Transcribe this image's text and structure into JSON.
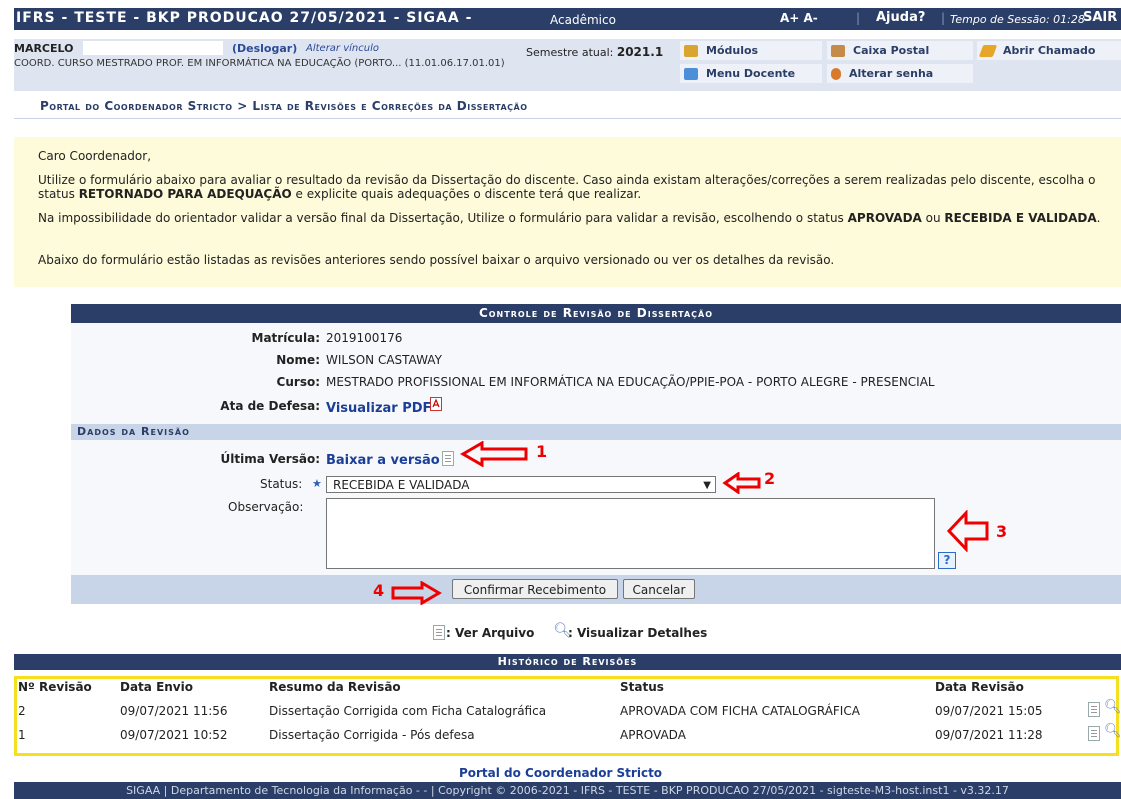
{
  "topbar": {
    "title": "IFRS - TESTE - BKP PRODUCAO 27/05/2021 - SIGAA -",
    "subtitle": "Acadêmico",
    "font_controls": "A+ A-",
    "help": "Ajuda?",
    "session": "Tempo de Sessão: 01:28",
    "logout": "SAIR"
  },
  "info": {
    "user": "MARCELO",
    "deslogar": "(Deslogar)",
    "alterar_vinculo": "Alterar vínculo",
    "coord": "COORD. CURSO MESTRADO PROF. EM INFORMÁTICA NA EDUCAÇÃO (PORTO... (11.01.06.17.01.01)",
    "semestre_label": "Semestre atual:",
    "semestre_value": "2021.1"
  },
  "menu": {
    "modulos": "Módulos",
    "caixa_postal": "Caixa Postal",
    "abrir_chamado": "Abrir Chamado",
    "menu_docente": "Menu Docente",
    "alterar_senha": "Alterar senha"
  },
  "breadcrumb": "Portal do Coordenador Stricto > Lista de Revisões e Correções da Dissertação",
  "notice": {
    "greeting": "Caro Coordenador,",
    "p1_a": "Utilize o formulário abaixo para avaliar o resultado da revisão da Dissertação do discente. Caso ainda existam alterações/correções a serem realizadas pelo discente, escolha o status ",
    "p1_b": "RETORNADO PARA ADEQUAÇÃO",
    "p1_c": " e explicite quais adequações o discente terá que realizar.",
    "p2_a": "Na impossibilidade do orientador validar a versão final da Dissertação, Utilize o formulário para validar a revisão, escolhendo o status ",
    "p2_b": "APROVADA",
    "p2_c": " ou ",
    "p2_d": "RECEBIDA E VALIDADA",
    "p2_e": ".",
    "p3": "Abaixo do formulário estão listadas as revisões anteriores sendo possível baixar o arquivo versionado ou ver os detalhes da revisão."
  },
  "form": {
    "header": "Controle de Revisão de Dissertação",
    "matricula_label": "Matrícula:",
    "matricula": "2019100176",
    "nome_label": "Nome:",
    "nome": "WILSON CASTAWAY",
    "curso_label": "Curso:",
    "curso": "MESTRADO PROFISSIONAL EM INFORMÁTICA NA EDUCAÇÃO/PPIE-POA - PORTO ALEGRE - PRESENCIAL",
    "ata_label": "Ata de Defesa:",
    "ata_link": "Visualizar PDF",
    "dados_header": "Dados da Revisão",
    "ultima_label": "Última Versão:",
    "ultima_link": "Baixar a versão",
    "status_label": "Status:",
    "status_value": "RECEBIDA E VALIDADA",
    "obs_label": "Observação:",
    "help": "?",
    "confirm": "Confirmar Recebimento",
    "cancel": "Cancelar"
  },
  "annotations": {
    "a1": "1",
    "a2": "2",
    "a3": "3",
    "a4": "4",
    "color": "#e00000"
  },
  "legend": {
    "ver_arquivo": ": Ver Arquivo",
    "visualizar": ": Visualizar Detalhes"
  },
  "history": {
    "header": "Histórico de Revisões",
    "columns": [
      "Nº Revisão",
      "Data Envio",
      "Resumo da Revisão",
      "Status",
      "Data Revisão"
    ],
    "rows": [
      [
        "2",
        "09/07/2021 11:56",
        "Dissertação Corrigida com Ficha Catalográfica",
        "APROVADA COM FICHA CATALOGRÁFICA",
        "09/07/2021 15:05"
      ],
      [
        "1",
        "09/07/2021 10:52",
        "Dissertação Corrigida - Pós defesa",
        "APROVADA",
        "09/07/2021 11:28"
      ]
    ]
  },
  "footer_link": "Portal do Coordenador Stricto",
  "footer": "SIGAA | Departamento de Tecnologia da Informação - - | Copyright © 2006-2021 - IFRS - TESTE - BKP PRODUCAO 27/05/2021 - sigteste-M3-host.inst1 - v3.32.17"
}
